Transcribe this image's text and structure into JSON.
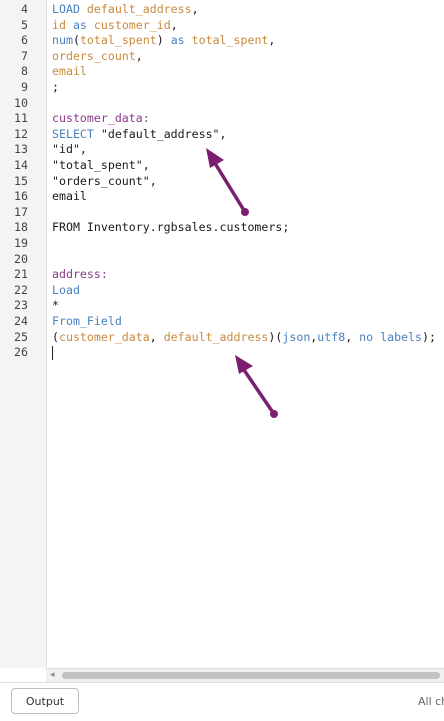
{
  "editor": {
    "lines": [
      {
        "n": "4",
        "t": [
          [
            "kw",
            "LOAD"
          ],
          [
            "plain",
            " "
          ],
          [
            "id",
            "default_address"
          ],
          [
            "plain",
            ","
          ]
        ]
      },
      {
        "n": "5",
        "t": [
          [
            "id",
            "id"
          ],
          [
            "plain",
            " "
          ],
          [
            "kw",
            "as"
          ],
          [
            "plain",
            " "
          ],
          [
            "id",
            "customer_id"
          ],
          [
            "plain",
            ","
          ]
        ]
      },
      {
        "n": "6",
        "t": [
          [
            "fn",
            "num"
          ],
          [
            "plain",
            "("
          ],
          [
            "id",
            "total_spent"
          ],
          [
            "plain",
            ") "
          ],
          [
            "kw",
            "as"
          ],
          [
            "plain",
            " "
          ],
          [
            "id",
            "total_spent"
          ],
          [
            "plain",
            ","
          ]
        ]
      },
      {
        "n": "7",
        "t": [
          [
            "id",
            "orders_count"
          ],
          [
            "plain",
            ","
          ]
        ]
      },
      {
        "n": "8",
        "t": [
          [
            "id",
            "email"
          ]
        ]
      },
      {
        "n": "9",
        "t": [
          [
            "plain",
            ";"
          ]
        ]
      },
      {
        "n": "10",
        "t": []
      },
      {
        "n": "11",
        "t": [
          [
            "lbl",
            "customer_data:"
          ]
        ]
      },
      {
        "n": "12",
        "t": [
          [
            "kw",
            "SELECT"
          ],
          [
            "plain",
            " "
          ],
          [
            "str",
            "\"default_address\","
          ]
        ]
      },
      {
        "n": "13",
        "t": [
          [
            "str",
            "\"id\","
          ]
        ]
      },
      {
        "n": "14",
        "t": [
          [
            "str",
            "\"total_spent\","
          ]
        ]
      },
      {
        "n": "15",
        "t": [
          [
            "str",
            "\"orders_count\","
          ]
        ]
      },
      {
        "n": "16",
        "t": [
          [
            "plain",
            "email"
          ]
        ]
      },
      {
        "n": "17",
        "t": []
      },
      {
        "n": "18",
        "t": [
          [
            "plain",
            "FROM Inventory.rgbsales.customers;"
          ]
        ]
      },
      {
        "n": "19",
        "t": []
      },
      {
        "n": "20",
        "t": []
      },
      {
        "n": "21",
        "t": [
          [
            "lbl",
            "address:"
          ]
        ]
      },
      {
        "n": "22",
        "t": [
          [
            "kw",
            "Load"
          ]
        ]
      },
      {
        "n": "23",
        "t": [
          [
            "plain",
            "*"
          ]
        ]
      },
      {
        "n": "24",
        "t": [
          [
            "kw",
            "From_Field"
          ]
        ]
      },
      {
        "n": "25",
        "t": [
          [
            "plain",
            "("
          ],
          [
            "id",
            "customer_data"
          ],
          [
            "plain",
            ", "
          ],
          [
            "id",
            "default_address"
          ],
          [
            "plain",
            ")("
          ],
          [
            "kw",
            "json"
          ],
          [
            "plain",
            ","
          ],
          [
            "kw",
            "utf8"
          ],
          [
            "plain",
            ", "
          ],
          [
            "kw",
            "no labels"
          ],
          [
            "plain",
            ");"
          ]
        ]
      },
      {
        "n": "26",
        "t": []
      }
    ]
  },
  "annotation": {
    "arrow_color": "#7a1f6e"
  },
  "footer": {
    "output_label": "Output",
    "status_text": "All ch"
  }
}
